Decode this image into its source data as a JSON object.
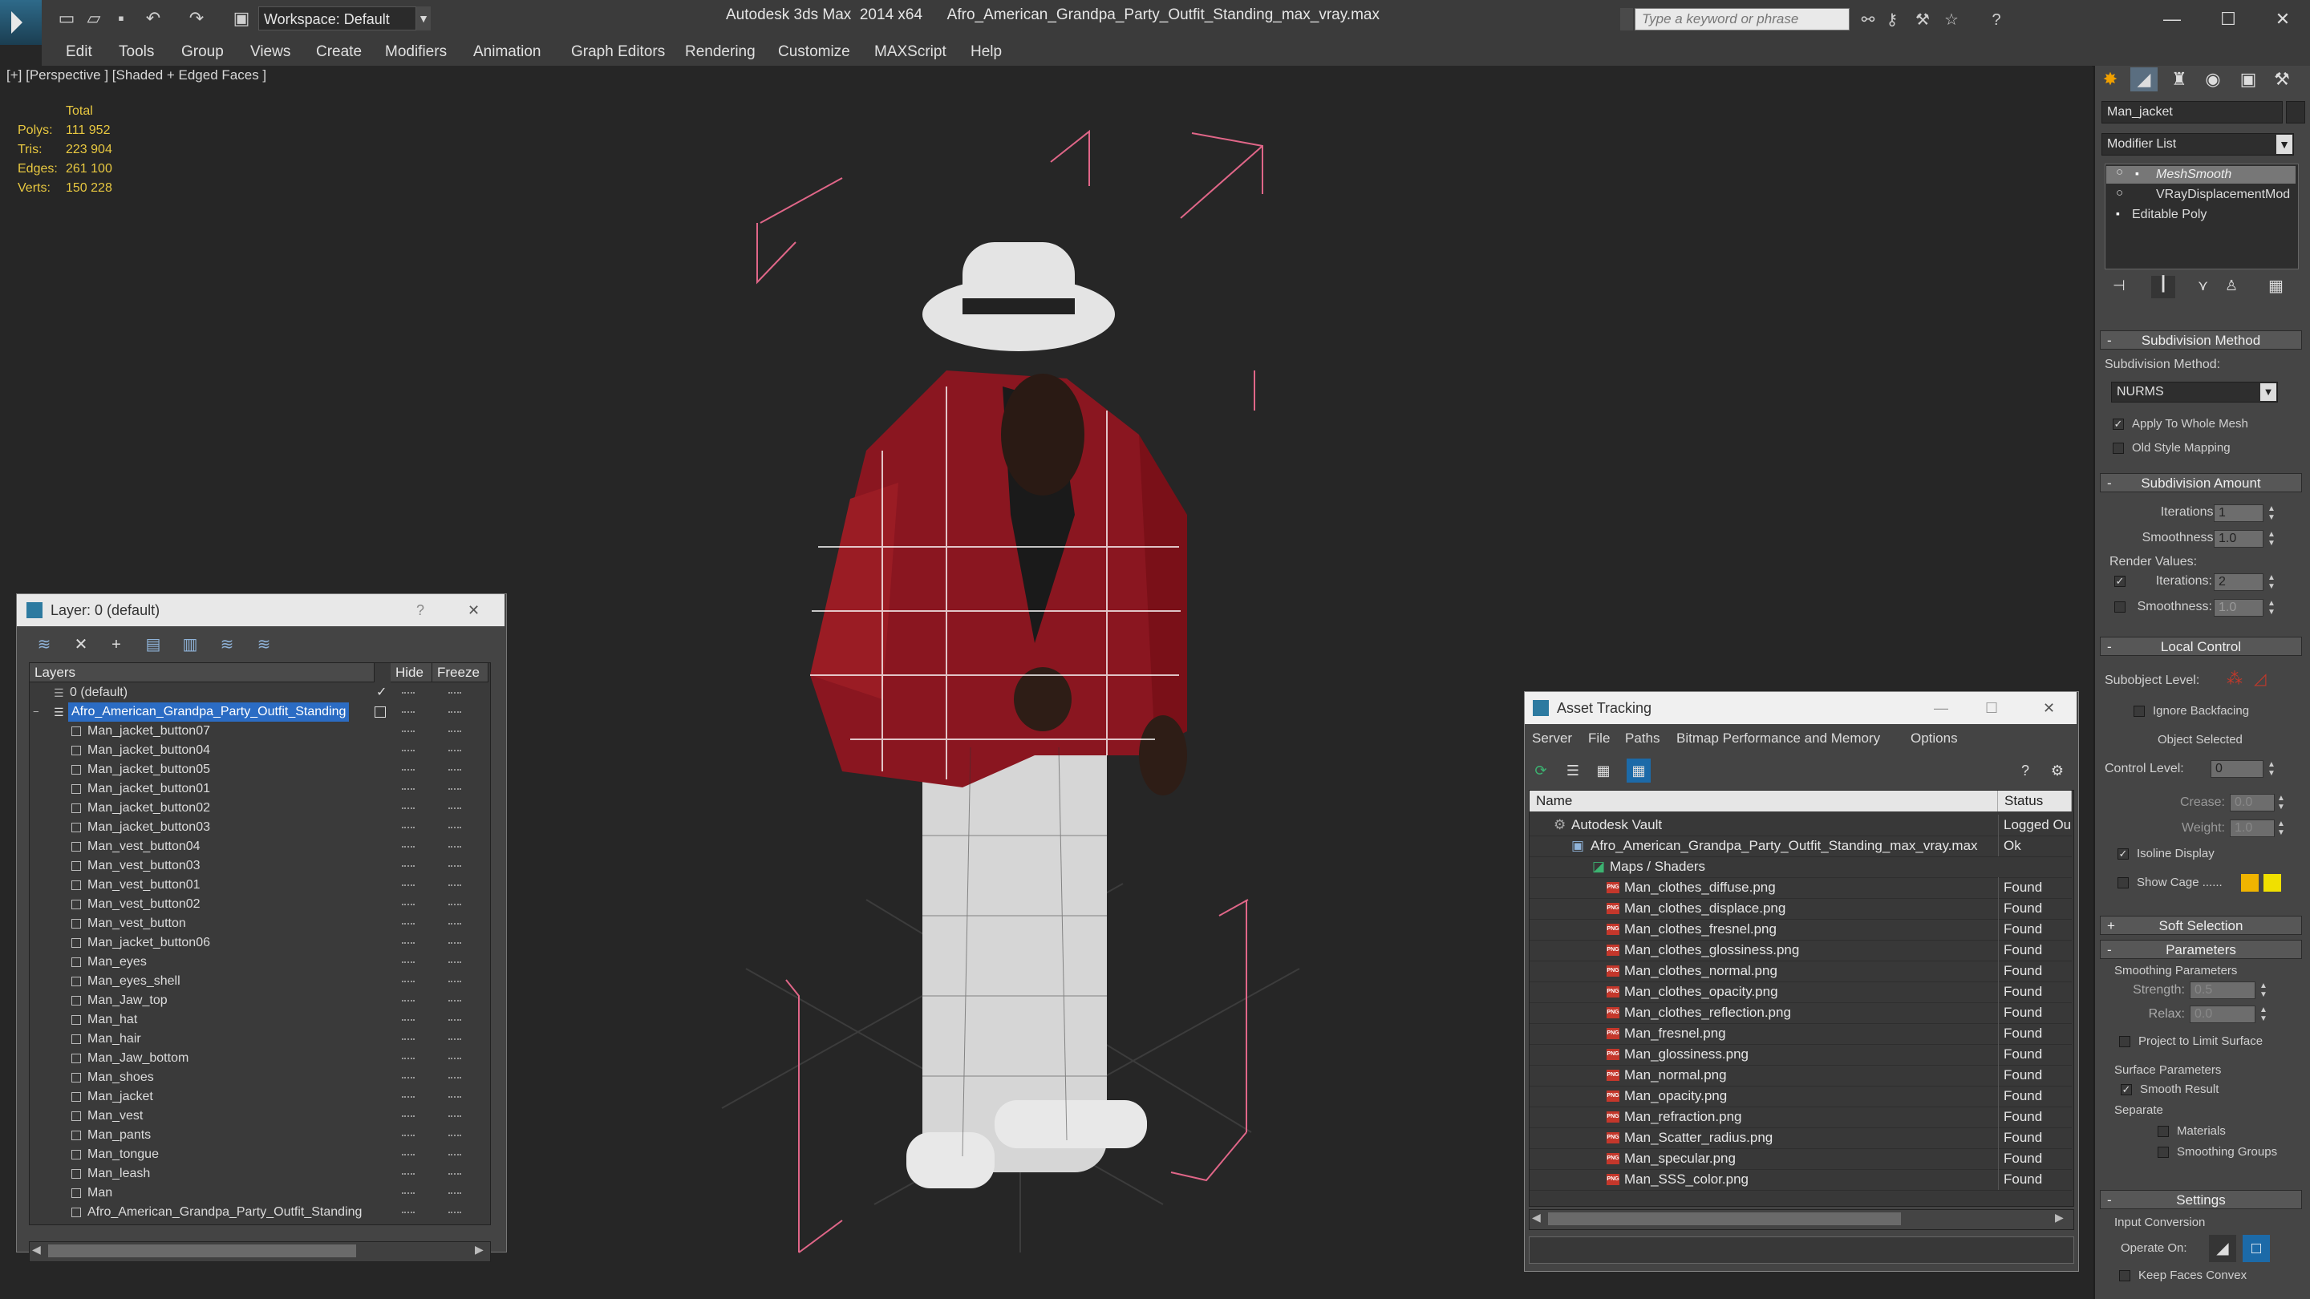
{
  "titlebar": {
    "workspace": "Workspace: Default",
    "app_title": "Autodesk 3ds Max  2014 x64      Afro_American_Grandpa_Party_Outfit_Standing_max_vray.max",
    "search_placeholder": "Type a keyword or phrase"
  },
  "menus": [
    "Edit",
    "Tools",
    "Group",
    "Views",
    "Create",
    "Modifiers",
    "Animation",
    "Graph Editors",
    "Rendering",
    "Customize",
    "MAXScript",
    "Help"
  ],
  "viewport": {
    "label": "[+] [Perspective ] [Shaded + Edged Faces ]",
    "stats_header": "Total",
    "stats": [
      {
        "label": "Polys:",
        "value": "111 952"
      },
      {
        "label": "Tris:",
        "value": "223 904"
      },
      {
        "label": "Edges:",
        "value": "261 100"
      },
      {
        "label": "Verts:",
        "value": "150 228"
      }
    ]
  },
  "command_panel": {
    "object_name": "Man_jacket",
    "modifier_list": "Modifier List",
    "stack": [
      "MeshSmooth",
      "VRayDisplacementMod",
      "Editable Poly"
    ],
    "subdivision_method_title": "Subdivision Method",
    "subdivision_method_label": "Subdivision Method:",
    "subdivision_method_value": "NURMS",
    "apply_whole_mesh": "Apply To Whole Mesh",
    "old_style_mapping": "Old Style Mapping",
    "subdivision_amount_title": "Subdivision Amount",
    "iterations_label": "Iterations:",
    "iterations_value": "1",
    "smoothness_label": "Smoothness:",
    "smoothness_value": "1.0",
    "render_values_label": "Render Values:",
    "render_iterations_label": "Iterations:",
    "render_iterations_value": "2",
    "render_smoothness_label": "Smoothness:",
    "render_smoothness_value": "1.0",
    "local_control_title": "Local Control",
    "subobject_level_label": "Subobject Level:",
    "ignore_backfacing": "Ignore Backfacing",
    "object_selected": "Object Selected",
    "control_level_label": "Control Level:",
    "control_level_value": "0",
    "crease_label": "Crease:",
    "crease_value": "0.0",
    "weight_label": "Weight:",
    "weight_value": "1.0",
    "isoline_display": "Isoline Display",
    "show_cage": "Show Cage ......",
    "soft_selection_title": "Soft Selection",
    "parameters_title": "Parameters",
    "smoothing_params": "Smoothing Parameters",
    "strength_label": "Strength:",
    "strength_value": "0.5",
    "relax_label": "Relax:",
    "relax_value": "0.0",
    "project_limit": "Project to Limit Surface",
    "surface_params": "Surface Parameters",
    "smooth_result": "Smooth Result",
    "separate_label": "Separate",
    "materials": "Materials",
    "smoothing_groups": "Smoothing Groups",
    "settings_title": "Settings",
    "input_conversion": "Input Conversion",
    "operate_on_label": "Operate On:",
    "keep_faces_convex": "Keep Faces Convex",
    "colors": {
      "cage1": "#f0b400",
      "cage2": "#f0e000"
    }
  },
  "layer_window": {
    "title": "Layer: 0 (default)",
    "col_layers": "Layers",
    "col_hide": "Hide",
    "col_freeze": "Freeze",
    "layer_default": "0 (default)",
    "layer_main": "Afro_American_Grandpa_Party_Outfit_Standing",
    "objects": [
      "Man_jacket_button07",
      "Man_jacket_button04",
      "Man_jacket_button05",
      "Man_jacket_button01",
      "Man_jacket_button02",
      "Man_jacket_button03",
      "Man_vest_button04",
      "Man_vest_button03",
      "Man_vest_button01",
      "Man_vest_button02",
      "Man_vest_button",
      "Man_jacket_button06",
      "Man_eyes",
      "Man_eyes_shell",
      "Man_Jaw_top",
      "Man_hat",
      "Man_hair",
      "Man_Jaw_bottom",
      "Man_shoes",
      "Man_jacket",
      "Man_vest",
      "Man_pants",
      "Man_tongue",
      "Man_leash",
      "Man",
      "Afro_American_Grandpa_Party_Outfit_Standing"
    ]
  },
  "asset_tracking": {
    "title": "Asset Tracking",
    "menus": [
      "Server",
      "File",
      "Paths",
      "Bitmap Performance and Memory",
      "Options"
    ],
    "col_name": "Name",
    "col_status": "Status",
    "vault": {
      "name": "Autodesk Vault",
      "status": "Logged Ou"
    },
    "file": {
      "name": "Afro_American_Grandpa_Party_Outfit_Standing_max_vray.max",
      "status": "Ok"
    },
    "maps_folder": "Maps / Shaders",
    "png_badge": "PNG",
    "maps": [
      {
        "name": "Man_clothes_diffuse.png",
        "status": "Found"
      },
      {
        "name": "Man_clothes_displace.png",
        "status": "Found"
      },
      {
        "name": "Man_clothes_fresnel.png",
        "status": "Found"
      },
      {
        "name": "Man_clothes_glossiness.png",
        "status": "Found"
      },
      {
        "name": "Man_clothes_normal.png",
        "status": "Found"
      },
      {
        "name": "Man_clothes_opacity.png",
        "status": "Found"
      },
      {
        "name": "Man_clothes_reflection.png",
        "status": "Found"
      },
      {
        "name": "Man_fresnel.png",
        "status": "Found"
      },
      {
        "name": "Man_glossiness.png",
        "status": "Found"
      },
      {
        "name": "Man_normal.png",
        "status": "Found"
      },
      {
        "name": "Man_opacity.png",
        "status": "Found"
      },
      {
        "name": "Man_refraction.png",
        "status": "Found"
      },
      {
        "name": "Man_Scatter_radius.png",
        "status": "Found"
      },
      {
        "name": "Man_specular.png",
        "status": "Found"
      },
      {
        "name": "Man_SSS_color.png",
        "status": "Found"
      }
    ]
  }
}
